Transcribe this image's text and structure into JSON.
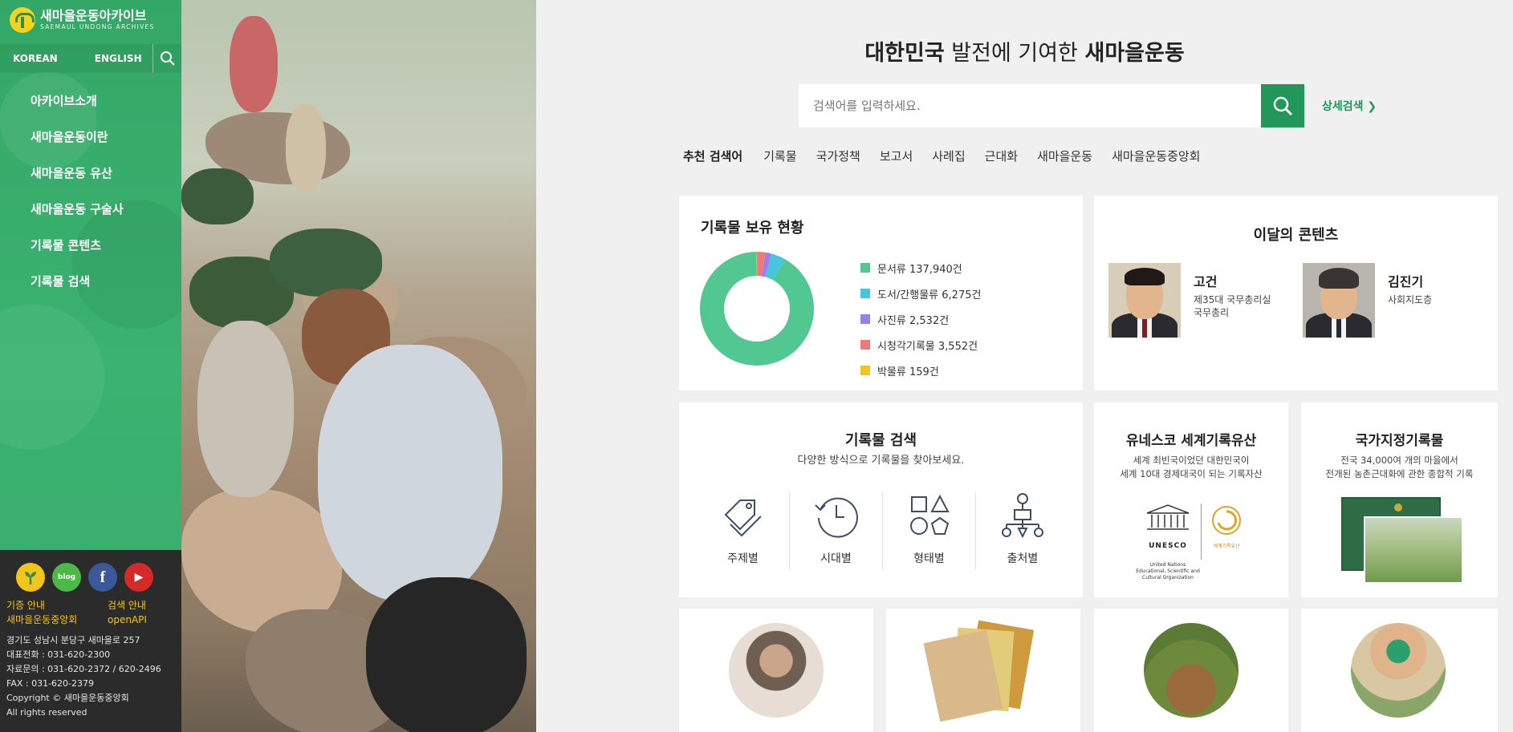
{
  "brand": {
    "title": "새마을운동아카이브",
    "subtitle": "SAEMAUL UNDONG ARCHIVES"
  },
  "lang": {
    "korean": "KOREAN",
    "english": "ENGLISH"
  },
  "nav": [
    "아카이브소개",
    "새마을운동이란",
    "새마을운동 유산",
    "새마을운동 구술사",
    "기록물 콘텐츠",
    "기록물 검색"
  ],
  "footer": {
    "social": [
      {
        "name": "saemaul-logo",
        "color": "#f3c51b",
        "label": ""
      },
      {
        "name": "blog",
        "color": "#4cb848",
        "label": "blog"
      },
      {
        "name": "facebook",
        "color": "#3b5998",
        "label": "f"
      },
      {
        "name": "youtube",
        "color": "#d42a2a",
        "label": "▶"
      }
    ],
    "links": [
      "기증 안내",
      "검색 안내",
      "새마을운동중앙회",
      "openAPI"
    ],
    "info": [
      "경기도 성남시 분당구 새마을로 257",
      "대표전화 : 031-620-2300",
      "자료문의 : 031-620-2372 / 620-2496",
      "FAX : 031-620-2379",
      "Copyright © 새마을운동중앙회",
      "All rights reserved"
    ]
  },
  "headline": {
    "part1": "대한민국",
    "part2": " 발전에 기여한 ",
    "part3": "새마을운동"
  },
  "search": {
    "placeholder": "검색어를 입력하세요.",
    "advanced": "상세검색 ❯"
  },
  "keywords": {
    "title": "추천 검색어",
    "items": [
      "기록물",
      "국가정책",
      "보고서",
      "사례집",
      "근대화",
      "새마을운동",
      "새마을운동중앙회"
    ]
  },
  "holdings": {
    "title": "기록물 보유 현황",
    "items": [
      {
        "label": "문서류 137,940건",
        "color": "#52c792"
      },
      {
        "label": "도서/간행물류 6,275건",
        "color": "#48c4dd"
      },
      {
        "label": "사진류 2,532건",
        "color": "#9a7ef0"
      },
      {
        "label": "시청각기록물 3,552건",
        "color": "#f27777"
      },
      {
        "label": "박물류 159건",
        "color": "#f3c51b"
      }
    ]
  },
  "chart_data": {
    "type": "pie",
    "categories": [
      "문서류",
      "도서/간행물류",
      "사진류",
      "시청각기록물",
      "박물류"
    ],
    "values": [
      137940,
      6275,
      2532,
      3552,
      159
    ]
  },
  "monthly": {
    "title": "이달의 콘텐츠",
    "people": [
      {
        "name": "고건",
        "desc": "제35대 국무총리실\n국무총리"
      },
      {
        "name": "김진기",
        "desc": "사회지도층"
      }
    ]
  },
  "record_search": {
    "title": "기록물 검색",
    "subtitle": "다양한 방식으로 기록물을 찾아보세요.",
    "cats": [
      "주제별",
      "시대별",
      "형태별",
      "출처별"
    ]
  },
  "unesco": {
    "title": "유네스코 세계기록유산",
    "sub1": "세계 최빈국이었던 대한민국이",
    "sub2": "세계 10대 경제대국이 되는 기록자산",
    "logo_text": "UNESCO",
    "org1": "United Nations",
    "org2": "Educational, Scientific and",
    "org3": "Cultural Organization",
    "mow": "세계기록유산"
  },
  "national": {
    "title": "국가지정기록물",
    "sub1": "전국 34,000여 개의 마을에서",
    "sub2": "전개된 농촌근대화에 관한 종합적 기록"
  }
}
